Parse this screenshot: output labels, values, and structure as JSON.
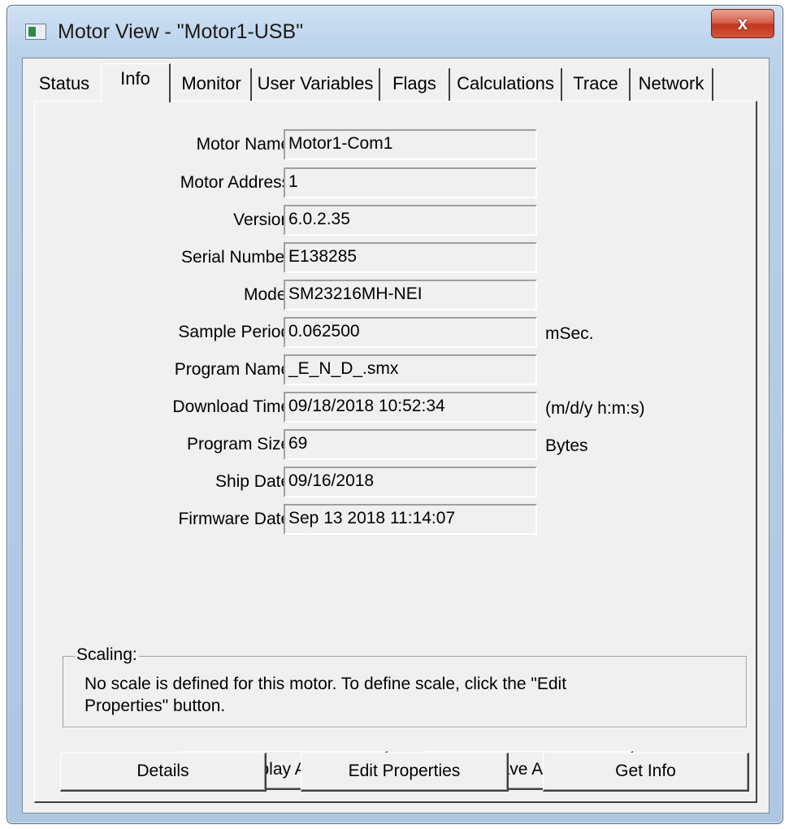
{
  "window": {
    "title": "Motor View - \"Motor1-USB\"",
    "close_label": "x"
  },
  "tabs": [
    {
      "label": "Status"
    },
    {
      "label": "Info"
    },
    {
      "label": "Monitor"
    },
    {
      "label": "User Variables"
    },
    {
      "label": "Flags"
    },
    {
      "label": "Calculations"
    },
    {
      "label": "Trace"
    },
    {
      "label": "Network"
    }
  ],
  "active_tab": "Info",
  "fields": [
    {
      "label": "Motor Name:",
      "value": "Motor1-Com1",
      "unit": ""
    },
    {
      "label": "Motor Address:",
      "value": "1",
      "unit": ""
    },
    {
      "label": "Version:",
      "value": "6.0.2.35",
      "unit": ""
    },
    {
      "label": "Serial Number:",
      "value": "E138285",
      "unit": ""
    },
    {
      "label": "Model:",
      "value": "SM23216MH-NEI",
      "unit": ""
    },
    {
      "label": "Sample Period:",
      "value": "0.062500",
      "unit": "mSec."
    },
    {
      "label": "Program Name:",
      "value": "_E_N_D_.smx",
      "unit": ""
    },
    {
      "label": "Download Time:",
      "value": "09/18/2018 10:52:34",
      "unit": "(m/d/y h:m:s)"
    },
    {
      "label": "Program Size:",
      "value": "69",
      "unit": "Bytes"
    },
    {
      "label": "Ship Date:",
      "value": "09/16/2018",
      "unit": ""
    },
    {
      "label": "Firmware Date:",
      "value": "Sep 13 2018 11:14:07",
      "unit": ""
    }
  ],
  "scaling": {
    "legend": "Scaling:",
    "text": "No scale is defined for this motor. To define scale, click the \"Edit Properties\" button."
  },
  "buttons": {
    "display_adb": "Display ADB",
    "save_adb": "Save ADB",
    "details": "Details",
    "edit_properties": "Edit Properties",
    "get_info": "Get Info"
  }
}
